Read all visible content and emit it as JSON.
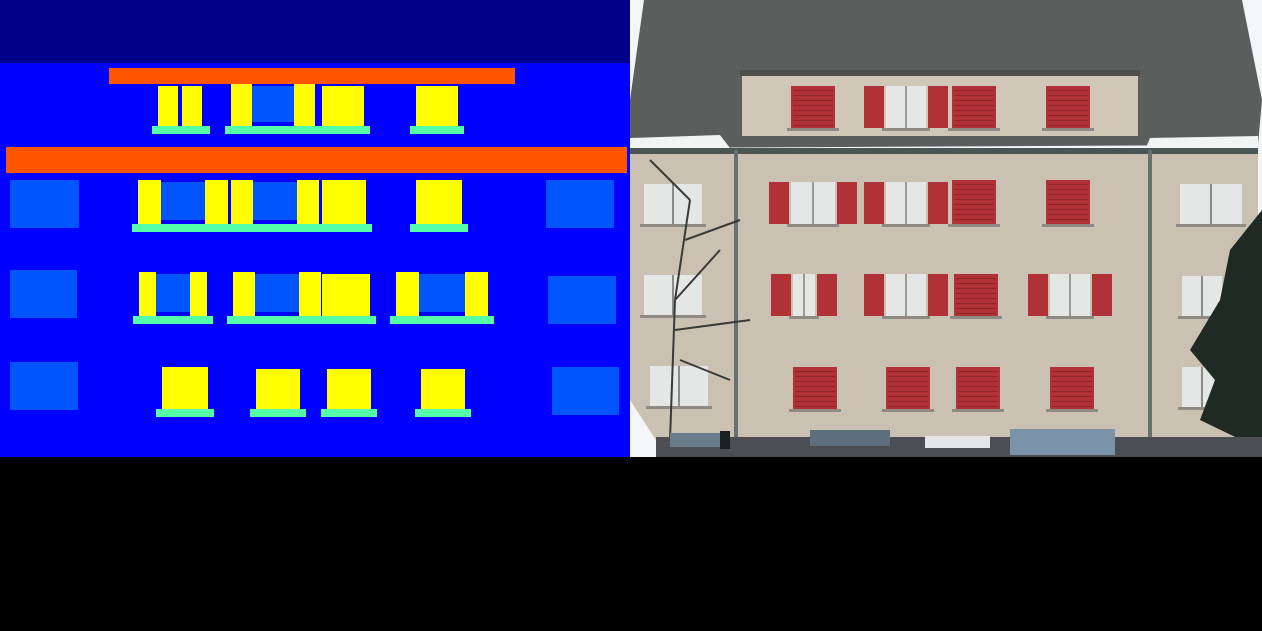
{
  "legend": {
    "background": "#0000ff",
    "roof": "#00008b",
    "wall": "#0000ff",
    "window": "#0055ff",
    "shutter": "#ffff00",
    "sill": "#55ffaa",
    "cornice": "#ff5500"
  },
  "photo": {
    "sky": "#f3f5f6",
    "roof": "#5a5d5c",
    "facade": "#cdc3b4",
    "shutter": "#b03236",
    "window": "#e5e6e6",
    "street": "#4a4d52"
  }
}
